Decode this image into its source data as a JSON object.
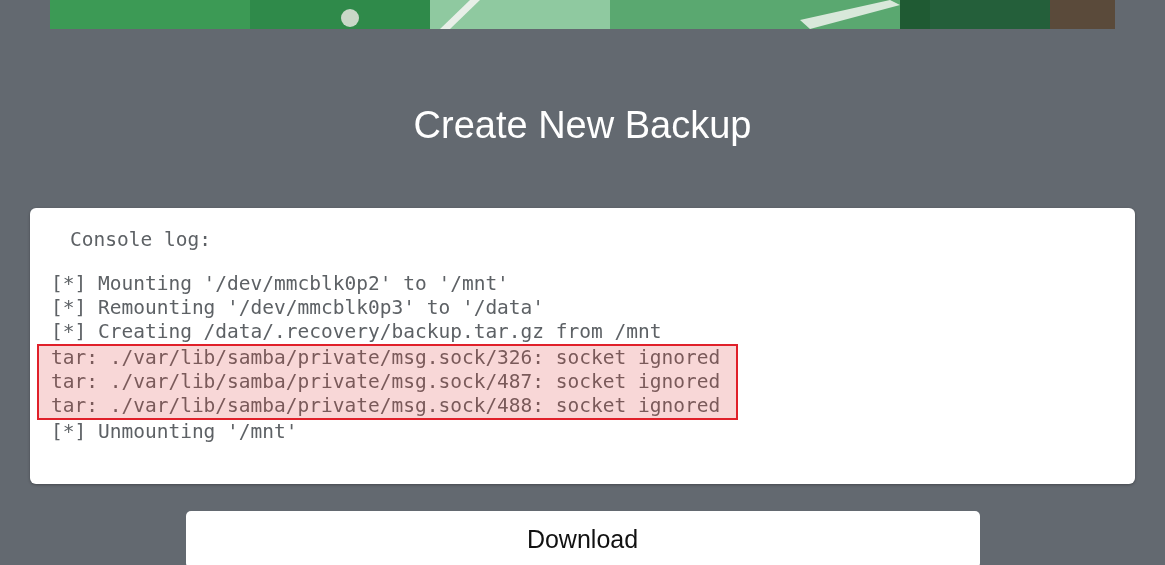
{
  "title": "Create New Backup",
  "console": {
    "label": "Console log:",
    "lines": [
      {
        "text": "[*] Mounting '/dev/mmcblk0p2' to '/mnt'",
        "highlighted": false
      },
      {
        "text": "[*] Remounting '/dev/mmcblk0p3' to '/data'",
        "highlighted": false
      },
      {
        "text": "[*] Creating /data/.recovery/backup.tar.gz from /mnt",
        "highlighted": false
      },
      {
        "text": "tar: ./var/lib/samba/private/msg.sock/326: socket ignored",
        "highlighted": true
      },
      {
        "text": "tar: ./var/lib/samba/private/msg.sock/487: socket ignored",
        "highlighted": true
      },
      {
        "text": "tar: ./var/lib/samba/private/msg.sock/488: socket ignored",
        "highlighted": true
      },
      {
        "text": "[*] Unmounting '/mnt'",
        "highlighted": false
      }
    ]
  },
  "download_button": "Download"
}
